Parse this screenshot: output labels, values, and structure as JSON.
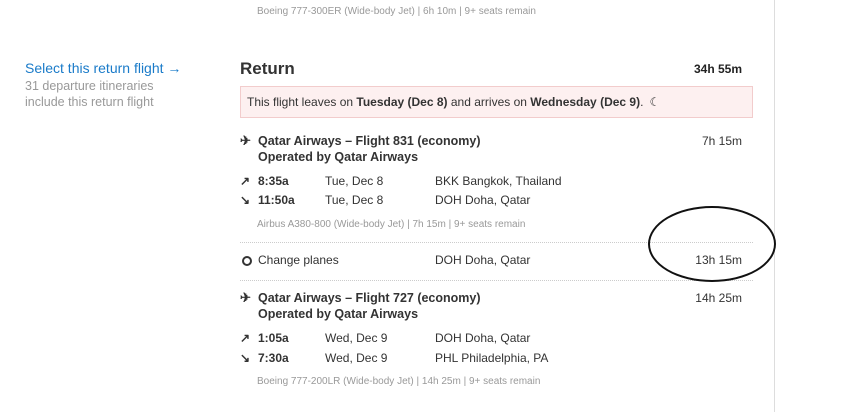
{
  "previous_flight_meta": "Boeing 777-300ER (Wide-body Jet)  |  6h 10m  |  9+ seats remain",
  "select_panel": {
    "link": "Select this return flight →",
    "subtext": "31 departure itineraries include this return flight"
  },
  "return": {
    "title": "Return",
    "total_duration": "34h 55m",
    "notice": {
      "prefix": "This flight leaves on ",
      "depart_day": "Tuesday (Dec 8)",
      "middle": " and arrives on ",
      "arrive_day": "Wednesday (Dec 9)",
      "suffix": ".",
      "icon": "moon-icon"
    }
  },
  "segments": [
    {
      "title": "Qatar Airways – Flight 831 (economy)",
      "operated_by": "Operated by Qatar Airways",
      "duration": "7h 15m",
      "depart": {
        "time": "8:35a",
        "date": "Tue, Dec 8",
        "airport": "BKK Bangkok, Thailand"
      },
      "arrive": {
        "time": "11:50a",
        "date": "Tue, Dec 8",
        "airport": "DOH Doha, Qatar"
      },
      "meta": "Airbus A380-800 (Wide-body Jet)  |  7h 15m  |  9+ seats remain"
    },
    {
      "title": "Qatar Airways – Flight 727 (economy)",
      "operated_by": "Operated by Qatar Airways",
      "duration": "14h 25m",
      "depart": {
        "time": "1:05a",
        "date": "Wed, Dec 9",
        "airport": "DOH Doha, Qatar"
      },
      "arrive": {
        "time": "7:30a",
        "date": "Wed, Dec 9",
        "airport": "PHL Philadelphia, PA"
      },
      "meta": "Boeing 777-200LR (Wide-body Jet)  |  14h 25m  |  9+ seats remain"
    }
  ],
  "layover": {
    "label": "Change planes",
    "airport": "DOH Doha, Qatar",
    "duration": "13h 15m"
  },
  "icons": {
    "plane": "plane-icon",
    "depart": "depart-arrow-icon",
    "arrive": "arrive-arrow-icon",
    "layover": "layover-circle-icon"
  },
  "colors": {
    "link": "#1a7bc9",
    "notice_bg": "#fdf0f0",
    "notice_border": "#f2cccc",
    "muted": "#999999"
  }
}
